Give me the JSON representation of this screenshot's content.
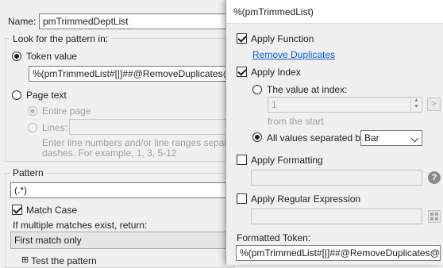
{
  "background_dialog": {
    "name_label": "Name:",
    "name_value": "pmTrimmedDeptList",
    "look_for_group_title": "Look for the pattern in:",
    "token_value_label": "Token value",
    "token_value_field": "%(pmTrimmedList#[|]##@RemoveDuplicates@#)",
    "page_text_label": "Page text",
    "entire_page_label": "Entire page",
    "lines_label": "Lines:",
    "lines_hint_1": "Enter line numbers and/or line ranges separated b",
    "lines_hint_2": "dashes.  For example, 1, 3, 5-12",
    "pattern_group_title": "Pattern",
    "pattern_value": "(.*)",
    "match_case_label": "Match Case",
    "multiple_matches_label": "If multiple matches exist, return:",
    "multiple_matches_selected": "First match only",
    "test_pattern_label": "Test the pattern",
    "test_pattern_expander": "⊞"
  },
  "popup": {
    "title": "%(pmTrimmedList)",
    "apply_function_label": "Apply Function",
    "function_link": "Remove Duplicates",
    "apply_index_label": "Apply Index",
    "value_at_index_label": "The value at index:",
    "index_value": "1",
    "go_button": ">",
    "from_start_label": "from the  start",
    "all_values_label": "All values separated by:",
    "separator_selected": "Bar",
    "apply_formatting_label": "Apply Formatting",
    "apply_regex_label": "Apply Regular Expression",
    "formatted_token_label": "Formatted Token:",
    "formatted_token_value": "%(pmTrimmedList#[|]##@RemoveDuplicates@#)",
    "help_glyph": "?"
  },
  "state": {
    "token_value_selected": true,
    "page_text_selected": false,
    "entire_page_selected": true,
    "match_case_checked": true,
    "apply_function_checked": true,
    "apply_index_checked": true,
    "value_at_index_selected": false,
    "all_values_selected": true,
    "apply_formatting_checked": false,
    "apply_regex_checked": false
  },
  "colors": {
    "link": "#0b5fd6",
    "background": "#f0f0f0"
  }
}
